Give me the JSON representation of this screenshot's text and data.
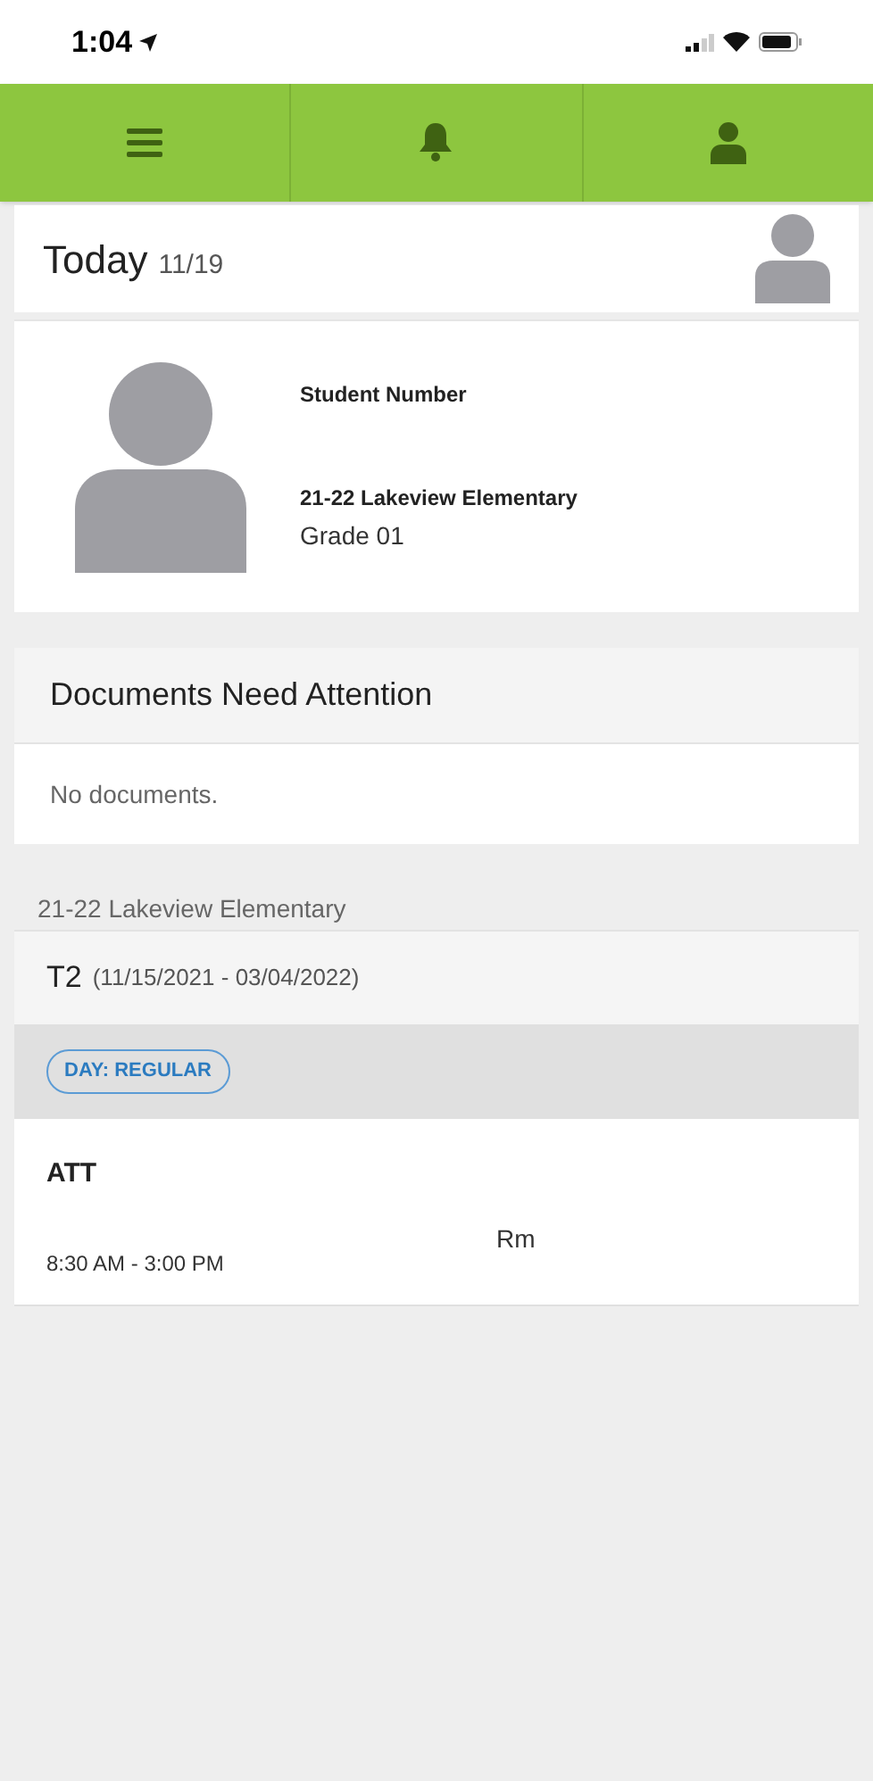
{
  "status_bar": {
    "time": "1:04"
  },
  "nav_tabs": [
    {
      "kind": "menu"
    },
    {
      "kind": "bell"
    },
    {
      "kind": "person"
    }
  ],
  "today": {
    "label": "Today",
    "date": "11/19"
  },
  "student": {
    "number_label": "Student Number",
    "school": "21-22 Lakeview Elementary",
    "grade": "Grade 01"
  },
  "documents": {
    "title": "Documents Need Attention",
    "message": "No documents."
  },
  "schedule": {
    "school": "21-22 Lakeview Elementary",
    "term": "T2",
    "term_dates": "(11/15/2021 - 03/04/2022)",
    "day_badge": "DAY: REGULAR",
    "periods": [
      {
        "name": "ATT",
        "time": "8:30 AM - 3:00 PM",
        "room": "Rm"
      }
    ]
  }
}
